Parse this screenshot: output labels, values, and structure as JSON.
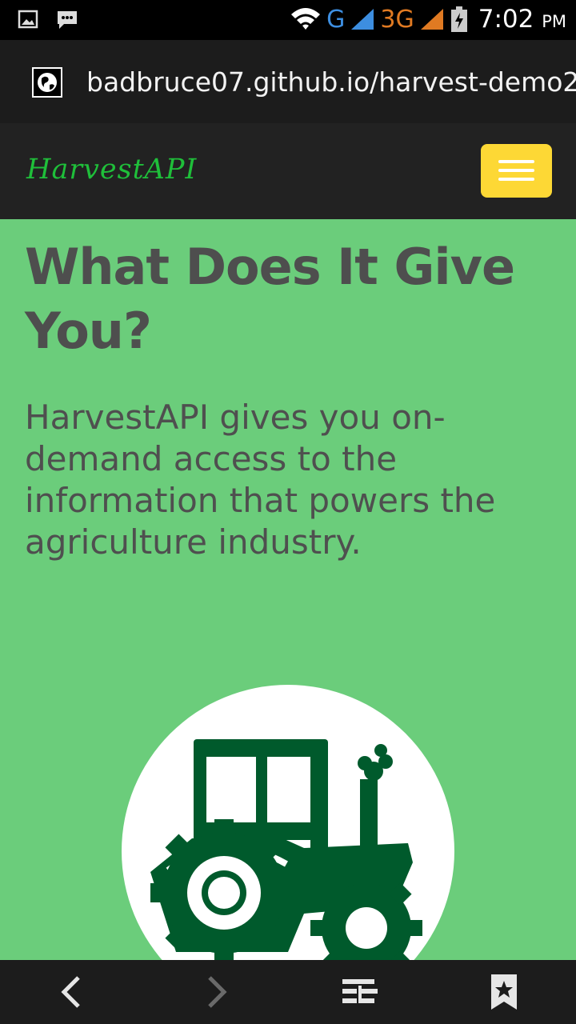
{
  "status_bar": {
    "network_g": "G",
    "network_3g": "3G",
    "time": "7:02",
    "ampm": "PM",
    "icons": [
      "gallery-icon",
      "message-icon",
      "wifi-icon",
      "signal-icon",
      "signal-icon",
      "battery-charging-icon"
    ]
  },
  "browser": {
    "url": "badbruce07.github.io/harvest-demo2",
    "site_icon": "globe-icon"
  },
  "navbar": {
    "brand": "HarvestAPI",
    "menu_icon": "hamburger-icon",
    "brand_color": "#1fbf3a",
    "menu_button_color": "#fdd835"
  },
  "section": {
    "heading": "What Does It Give You?",
    "body": "HarvestAPI gives you on-demand access to the information that powers the agriculture industry.",
    "background_color": "#6bcd7b",
    "illustration": "tractor-icon"
  },
  "bottom_nav": {
    "items": [
      "back-icon",
      "forward-icon",
      "tabs-icon",
      "bookmark-icon"
    ]
  }
}
